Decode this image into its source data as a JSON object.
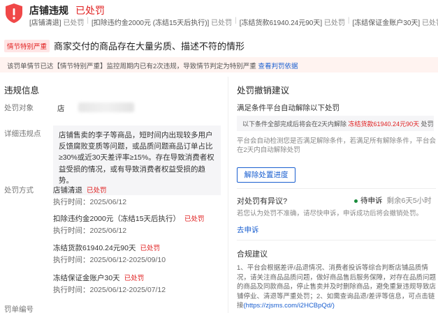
{
  "header": {
    "title": "店铺违规",
    "status": "已处罚",
    "tags": [
      {
        "text": "[店铺清退]",
        "status": "已处罚"
      },
      {
        "text": "[扣除违约金2000元 (冻结15天后执行)]",
        "status": "已处罚"
      },
      {
        "text": "[冻结货款61940.24元90天]",
        "status": "已处罚"
      },
      {
        "text": "[冻结保证金账户30天]",
        "status": "已处罚"
      }
    ]
  },
  "alert": {
    "badge": "情节特别严重",
    "text": "商家交付的商品存在大量劣质、描述不符的情形"
  },
  "notice": {
    "text": "该罚单情节已达【情节特别严重】监控周期内已有2次违规，导致情节判定为特别严重",
    "link": "查看判罚依据"
  },
  "violation": {
    "section_title": "违规信息",
    "target_label": "处罚对象",
    "target_value": "店",
    "detail_label": "详细违规点",
    "detail_text": "店铺售卖的李子等商品，短时间内出现较多用户反馈腐败变质等问题，或品质问题商品订单占比≥30%或近30天差评率≥15%。存在导致消费者权益受损的情况，或有导致消费者权益受损的趋势。",
    "method_label": "处罚方式",
    "punishments": [
      {
        "name": "店铺清退",
        "status": "已处罚",
        "time": "执行时间：2025/06/12"
      },
      {
        "name": "扣除违约金2000元（冻结15天后执行）",
        "status": "已处罚",
        "time": "执行时间：2025/06/12"
      },
      {
        "name": "冻结货款61940.24元90天",
        "status": "已处罚",
        "time": "执行时间：2025/06/12-2025/09/10"
      },
      {
        "name": "冻结保证金账户30天",
        "status": "已处罚",
        "time": "执行时间：2025/06/12-2025/07/12"
      }
    ],
    "number_label": "罚单编号"
  },
  "revoke": {
    "section_title": "处罚撤销建议",
    "sub_title": "满足条件平台自动解除以下处罚",
    "cond_prefix": "以下条件全部完成后将会在2天内解除",
    "cond_red": "冻结货款61940.24元90天",
    "cond_suffix": "处罚",
    "note": "平台会自动检测您是否满足解除条件，若满足所有解除条件，平台会在2天内自动解除处罚",
    "button": "解除处置进度"
  },
  "appeal": {
    "title": "对处罚有异议?",
    "status": "待申诉",
    "remaining": "剩余6天5小时",
    "note": "若您认为处罚不准确，请尽快申诉，申诉成功后将会撤销处罚。",
    "link": "去申诉"
  },
  "advice": {
    "title": "合规建议",
    "text": "1、平台会根据差评/品退情况、消费者投诉等综合判断店铺品质情况，请关注商品品质问题，做好商品售后服务保障，对存在品质问题的商品及同款商品，停止售卖并及时删除商品，避免重复违规导致店铺停业、清退等严重处罚；2、如需查询品退/差评等信息，可点击链接",
    "link": "(https://zjsms.com/i2HCBpQd/)"
  },
  "colors": {
    "red": "#e02020",
    "blue": "#1a5fd0",
    "green": "#1a8c3c"
  }
}
